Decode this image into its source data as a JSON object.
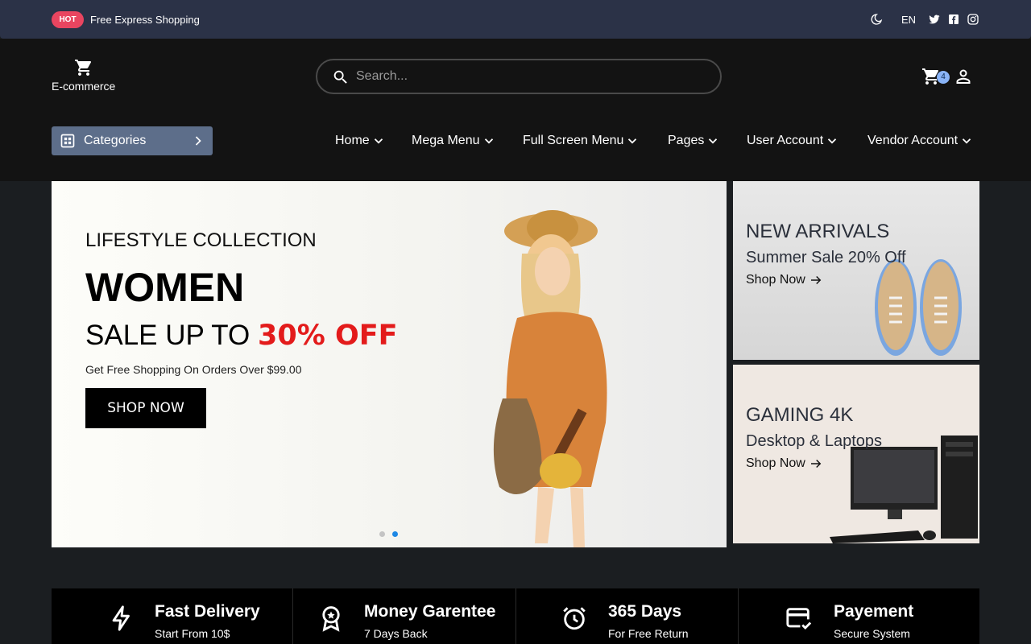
{
  "topbar": {
    "badge": "HOT",
    "promo": "Free Express Shopping",
    "language": "EN",
    "icons": [
      "moon-icon",
      "twitter-icon",
      "facebook-icon",
      "instagram-icon"
    ]
  },
  "header": {
    "logo_text": "E-commerce",
    "search_placeholder": "Search...",
    "cart_count": "4",
    "categories_label": "Categories",
    "nav": [
      {
        "label": "Home"
      },
      {
        "label": "Mega Menu"
      },
      {
        "label": "Full Screen Menu"
      },
      {
        "label": "Pages"
      },
      {
        "label": "User Account"
      },
      {
        "label": "Vendor Account"
      }
    ]
  },
  "hero": {
    "subtitle": "LIFESTYLE COLLECTION",
    "title": "WOMEN",
    "sale_prefix": "SALE UP TO ",
    "sale_highlight": "30% OFF",
    "description": "Get Free Shopping On Orders Over $99.00",
    "button": "SHOP NOW",
    "slides": 2,
    "active_slide": 2
  },
  "banners": [
    {
      "title": "NEW ARRIVALS",
      "subtitle": "Summer Sale 20% Off",
      "link": "Shop Now"
    },
    {
      "title": "GAMING 4K",
      "subtitle": "Desktop & Laptops",
      "link": "Shop Now"
    }
  ],
  "features": [
    {
      "icon": "lightning-icon",
      "title": "Fast Delivery",
      "subtitle": "Start From 10$"
    },
    {
      "icon": "award-icon",
      "title": "Money Garentee",
      "subtitle": "7 Days Back"
    },
    {
      "icon": "alarm-clock-icon",
      "title": "365 Days",
      "subtitle": "For Free Return"
    },
    {
      "icon": "credit-card-icon",
      "title": "Payement",
      "subtitle": "Secure System"
    }
  ],
  "colors": {
    "topbar": "#2b3247",
    "header": "#131313",
    "hot_badge": "#e94560",
    "categories": "#5d6e8a",
    "sale_red": "#e31b1b",
    "active_dot": "#1e88e5"
  }
}
